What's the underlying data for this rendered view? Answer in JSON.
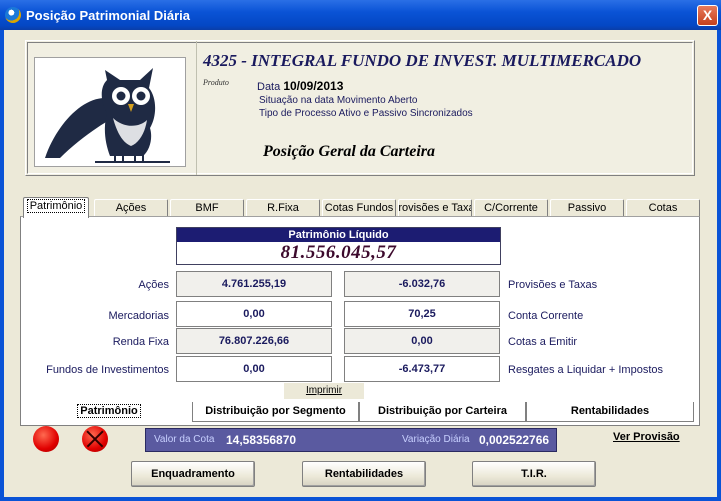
{
  "window": {
    "title": "Posição Patrimonial Diária",
    "close_label": "X"
  },
  "header": {
    "fund_name": "4325 - INTEGRAL FUNDO DE INVEST. MULTIMERCADO",
    "produto_label": "Produto",
    "data_label": "Data",
    "data_value": "10/09/2013",
    "situacao": "Situação na data Movimento Aberto",
    "tipo_processo": "Tipo de Processo Ativo e Passivo Sincronizados",
    "section_title": "Posição Geral da Carteira"
  },
  "top_tabs": [
    {
      "label": "Patrimônio"
    },
    {
      "label": "Ações"
    },
    {
      "label": "BMF"
    },
    {
      "label": "R.Fixa"
    },
    {
      "label": "Cotas Fundos"
    },
    {
      "label": "Provisões e Taxas"
    },
    {
      "label": "C/Corrente"
    },
    {
      "label": "Passivo"
    },
    {
      "label": "Cotas"
    }
  ],
  "patrimonio": {
    "title": "Patrimônio Líquido",
    "value": "81.556.045,57"
  },
  "left_rows": [
    {
      "label": "Ações",
      "value": "4.761.255,19"
    },
    {
      "label": "Mercadorias",
      "value": "0,00"
    },
    {
      "label": "Renda Fixa",
      "value": "76.807.226,66"
    },
    {
      "label": "Fundos de Investimentos",
      "value": "0,00"
    }
  ],
  "right_rows": [
    {
      "label": "Provisões e Taxas",
      "value": "-6.032,76"
    },
    {
      "label": "Conta Corrente",
      "value": "70,25"
    },
    {
      "label": "Cotas a Emitir",
      "value": "0,00"
    },
    {
      "label": "Resgates a Liquidar + Impostos",
      "value": "-6.473,77"
    }
  ],
  "imprimir_label": "Imprimir",
  "bottom_tabs": [
    {
      "label": "Patrimônio"
    },
    {
      "label": "Distribuição por Segmento"
    },
    {
      "label": "Distribuição por Carteira"
    },
    {
      "label": "Rentabilidades"
    }
  ],
  "quota": {
    "valor_label": "Valor da Cota",
    "valor_value": "14,58356870",
    "variacao_label": "Variação Diária",
    "variacao_value": "0,002522766"
  },
  "ver_provisao_label": "Ver Provisão",
  "buttons": {
    "enquadramento": "Enquadramento",
    "rentabilidades": "Rentabilidades",
    "tir": "T.I.R."
  },
  "colors": {
    "title_bar": "#0a53d6",
    "pl_header": "#1c1c72",
    "quota_bar": "#5a5aa0",
    "status_red": "#e00000"
  },
  "icons": [
    "app-icon",
    "owl-logo-icon",
    "status-circle-icon",
    "status-circle-x-icon",
    "close-icon"
  ]
}
